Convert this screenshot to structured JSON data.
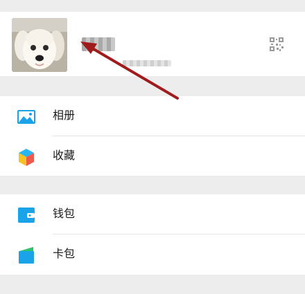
{
  "menu": {
    "group1": [
      {
        "label": "相册",
        "icon": "album-icon"
      },
      {
        "label": "收藏",
        "icon": "favorites-icon"
      }
    ],
    "group2": [
      {
        "label": "钱包",
        "icon": "wallet-icon"
      },
      {
        "label": "卡包",
        "icon": "card-pack-icon"
      }
    ]
  },
  "profile": {
    "avatar": "avatar-photo-puppy",
    "qr_icon": "qr-code-icon"
  },
  "annotation": {
    "arrow_color": "#a01c1c"
  }
}
